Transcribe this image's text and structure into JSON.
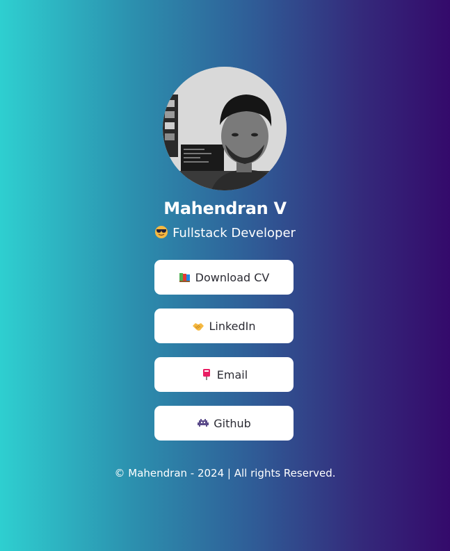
{
  "profile": {
    "name": "Mahendran V",
    "role_emoji": "smiling-face-with-sunglasses-icon",
    "role": "Fullstack Developer",
    "avatar": "profile-photo"
  },
  "links": [
    {
      "label": "Download CV",
      "icon": "books-icon"
    },
    {
      "label": "LinkedIn",
      "icon": "handshake-icon"
    },
    {
      "label": "Email",
      "icon": "postbox-icon"
    },
    {
      "label": "Github",
      "icon": "space-invader-icon"
    }
  ],
  "footer": {
    "text": "© Mahendran - 2024 | All rights Reserved."
  },
  "colors": {
    "gradient_start": "#2ecfd0",
    "gradient_end": "#340a6b",
    "button_bg": "#ffffff",
    "button_text": "#2b2b33"
  }
}
